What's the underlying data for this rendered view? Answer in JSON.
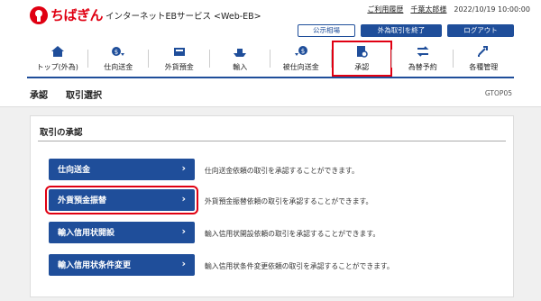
{
  "header": {
    "brand": "ちばぎん",
    "service": "インターネットEBサービス <Web-EB>",
    "usage_history": "ご利用履歴",
    "user_name": "千葉太郎様",
    "datetime": "2022/10/19 10:00:00",
    "public_rate": "公示相場",
    "end_fx": "外為取引を終了",
    "logout": "ログアウト"
  },
  "nav": {
    "items": [
      {
        "label": "トップ(外為)",
        "icon": "home-icon"
      },
      {
        "label": "仕向送金",
        "icon": "send-money-icon"
      },
      {
        "label": "外貨預金",
        "icon": "deposit-icon"
      },
      {
        "label": "輸入",
        "icon": "import-icon"
      },
      {
        "label": "被仕向送金",
        "icon": "receive-money-icon"
      },
      {
        "label": "承認",
        "icon": "approval-icon"
      },
      {
        "label": "為替予約",
        "icon": "fx-contract-icon"
      },
      {
        "label": "各種管理",
        "icon": "management-icon"
      }
    ]
  },
  "page": {
    "title": "承認",
    "subtitle": "取引選択",
    "code": "GTOP05"
  },
  "panel": {
    "title": "取引の承認",
    "rows": [
      {
        "label": "仕向送金",
        "desc": "仕向送金依頼の取引を承認することができます。"
      },
      {
        "label": "外貨預金振替",
        "desc": "外貨預金振替依頼の取引を承認することができます。"
      },
      {
        "label": "輸入信用状開設",
        "desc": "輸入信用状開設依頼の取引を承認することができます。"
      },
      {
        "label": "輸入信用状条件変更",
        "desc": "輸入信用状条件変更依頼の取引を承認することができます。"
      }
    ]
  },
  "colors": {
    "brand_red": "#e00012",
    "primary_blue": "#1f4e9a"
  }
}
